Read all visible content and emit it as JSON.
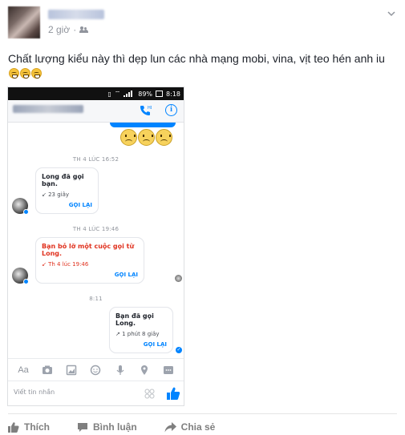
{
  "post": {
    "time": "2 giờ",
    "separator": "·",
    "text": "Chất lượng kiểu này thì dẹp lun các nhà mạng mobi, vina, vịt teo hén anh iu"
  },
  "phone": {
    "status": {
      "battery": "89%",
      "time": "8:18"
    },
    "messages": {
      "ts1": "TH 4 LÚC 16:52",
      "card1": {
        "title": "Long đã gọi bạn.",
        "sub": "↙ 23 giây",
        "action": "GỌI LẠI"
      },
      "ts2": "TH 4 LÚC 19:46",
      "card2": {
        "title": "Bạn bỏ lỡ một cuộc gọi từ Long.",
        "sub": "↙ Th 4 lúc 19:46",
        "action": "GỌI LẠI"
      },
      "ts3": "8:11",
      "card3": {
        "title": "Bạn đã gọi Long.",
        "sub": "↗ 1 phút 8 giây",
        "action": "GỌI LẠI"
      }
    },
    "toolbar": {
      "aa": "Aa"
    },
    "composer": {
      "placeholder": "Viết tin nhắn"
    }
  },
  "actions": {
    "like": "Thích",
    "comment": "Bình luận",
    "share": "Chia sẻ"
  },
  "colors": {
    "messenger_blue": "#0084ff",
    "missed_red": "#e0321f",
    "fb_gray": "#90949c"
  }
}
